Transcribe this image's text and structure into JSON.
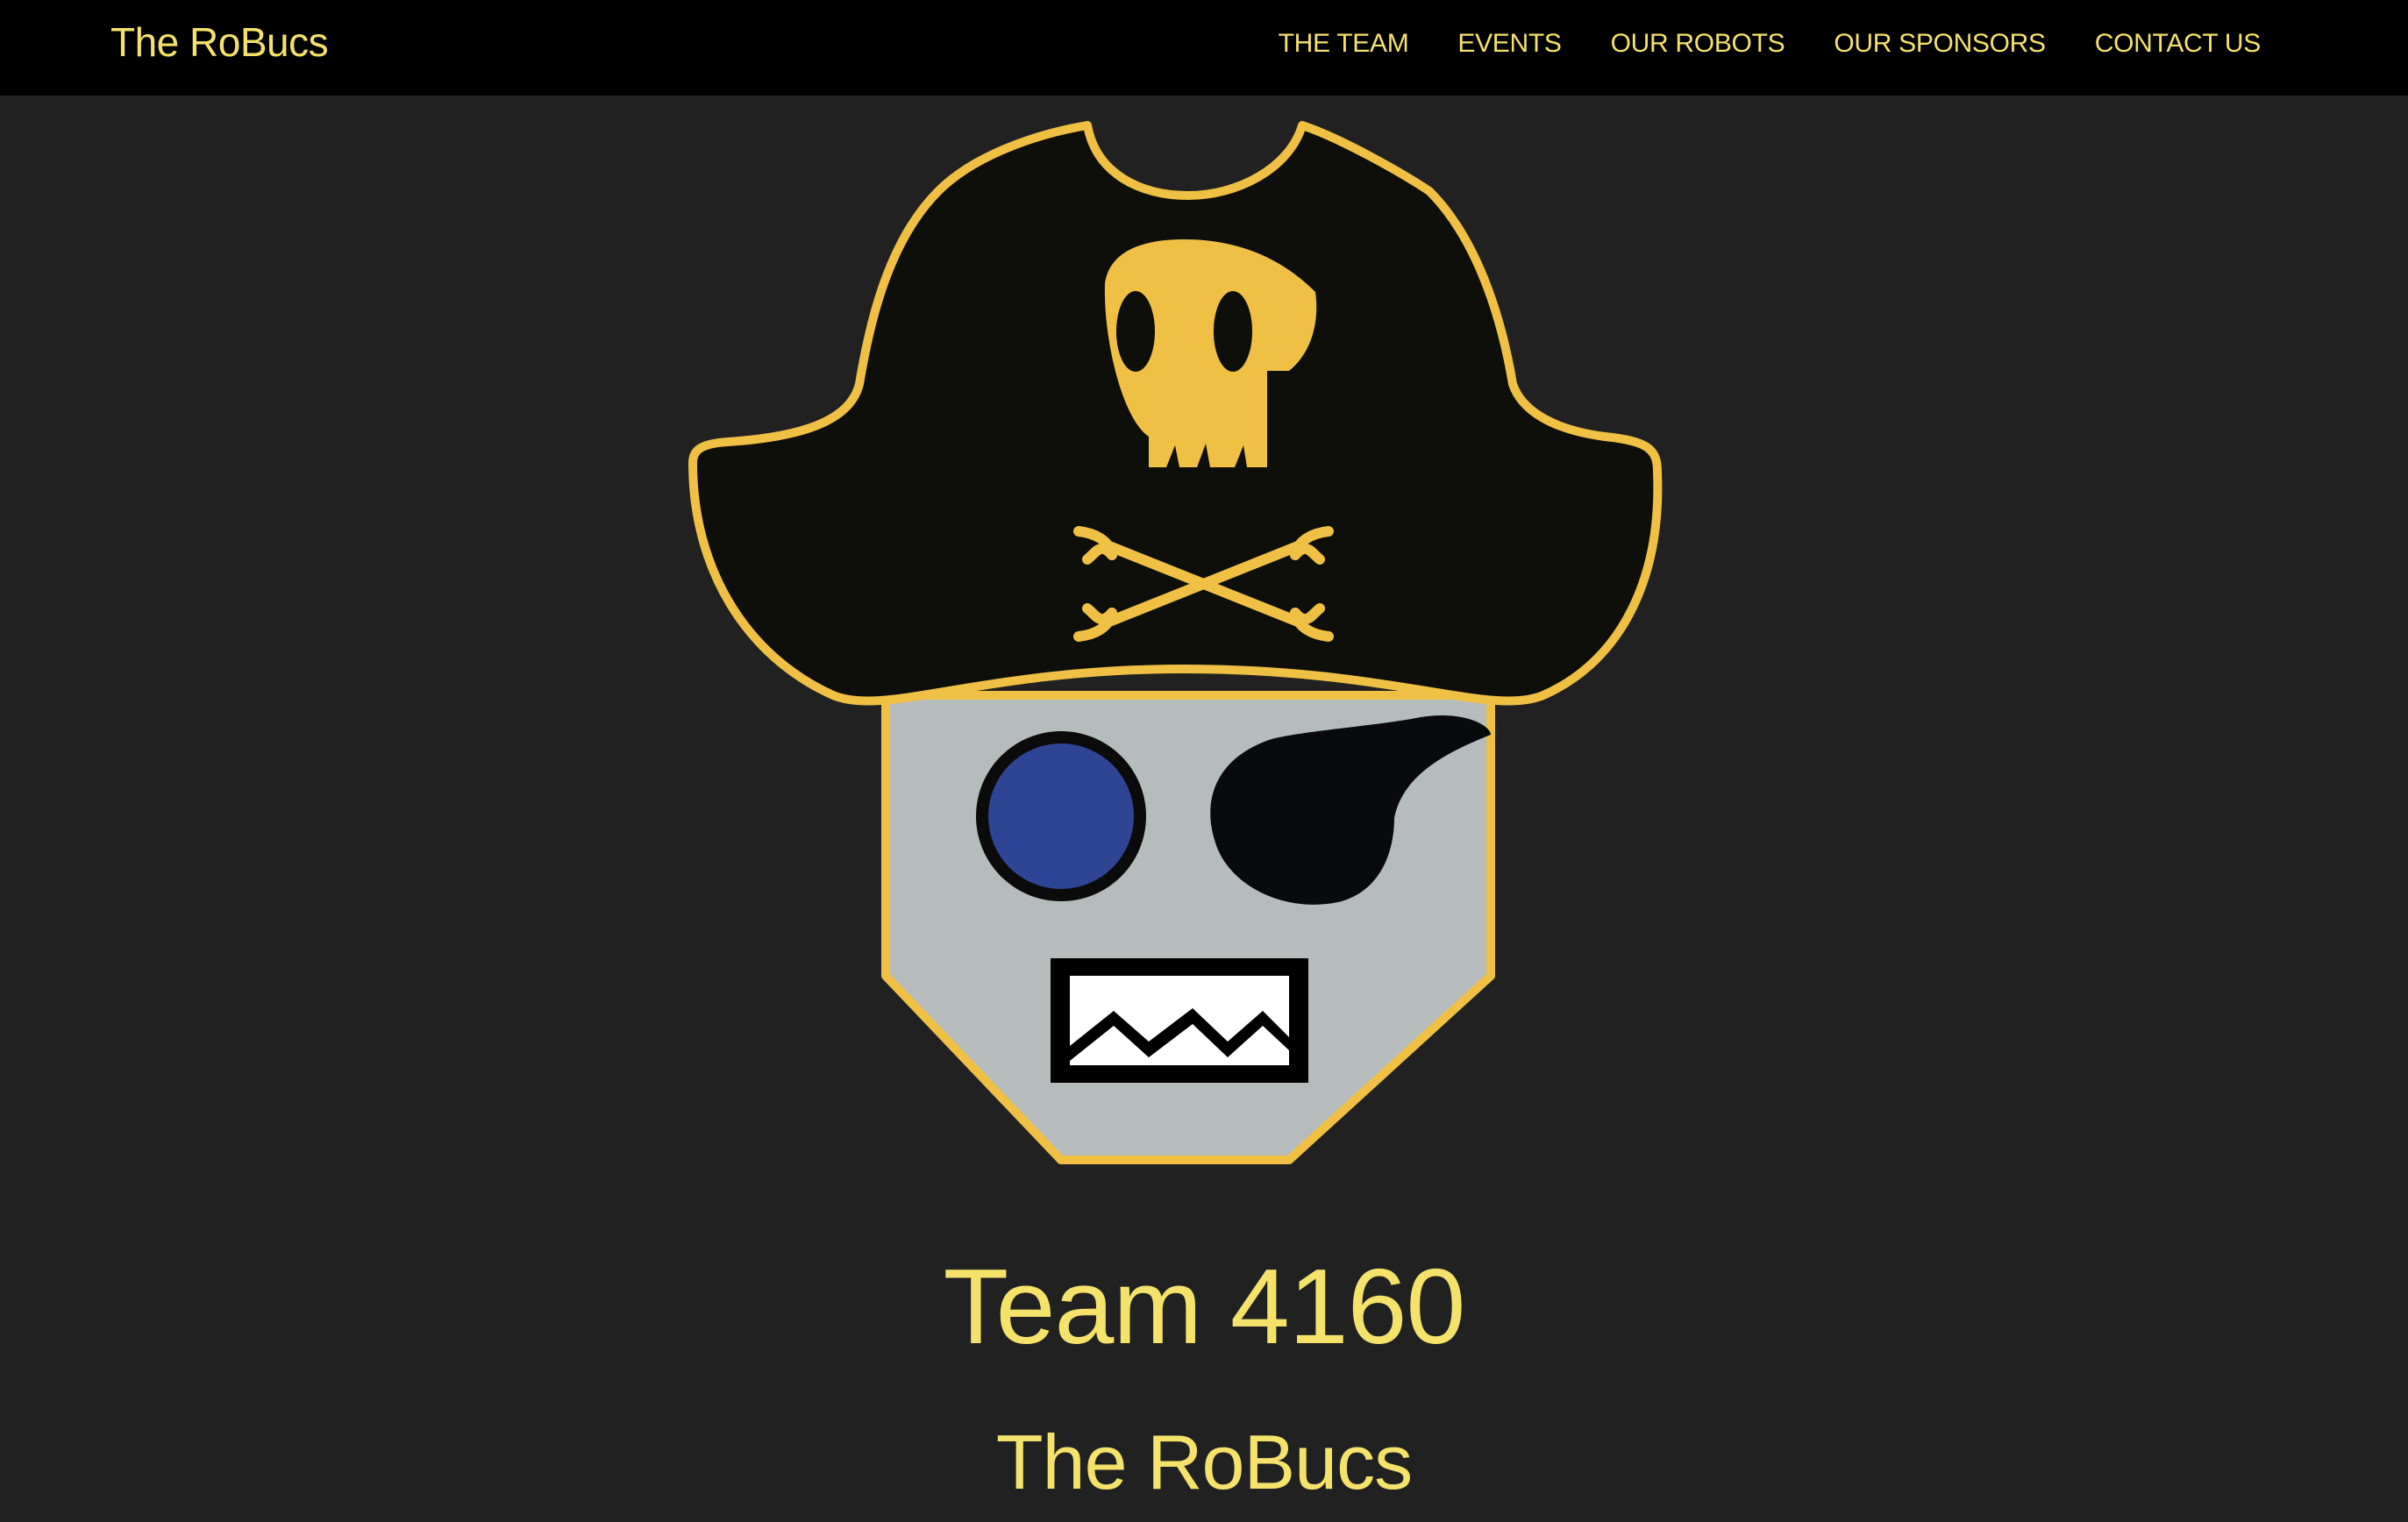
{
  "navbar": {
    "brand": "The RoBucs",
    "links": [
      {
        "label": "THE TEAM"
      },
      {
        "label": "EVENTS"
      },
      {
        "label": "OUR ROBOTS"
      },
      {
        "label": "OUR SPONSORS"
      },
      {
        "label": "CONTACT US"
      }
    ]
  },
  "hero": {
    "logo_icon": "pirate-robot-logo-icon",
    "title": "Team 4160",
    "subtitle": "The RoBucs"
  },
  "colors": {
    "background": "#212121",
    "navbar": "#000000",
    "accent_text": "#f5e26b",
    "logo_gold": "#efc044",
    "hat_black": "#0e0e0b",
    "face_gray": "#b6bcbc",
    "eye_blue": "#2e4596"
  }
}
